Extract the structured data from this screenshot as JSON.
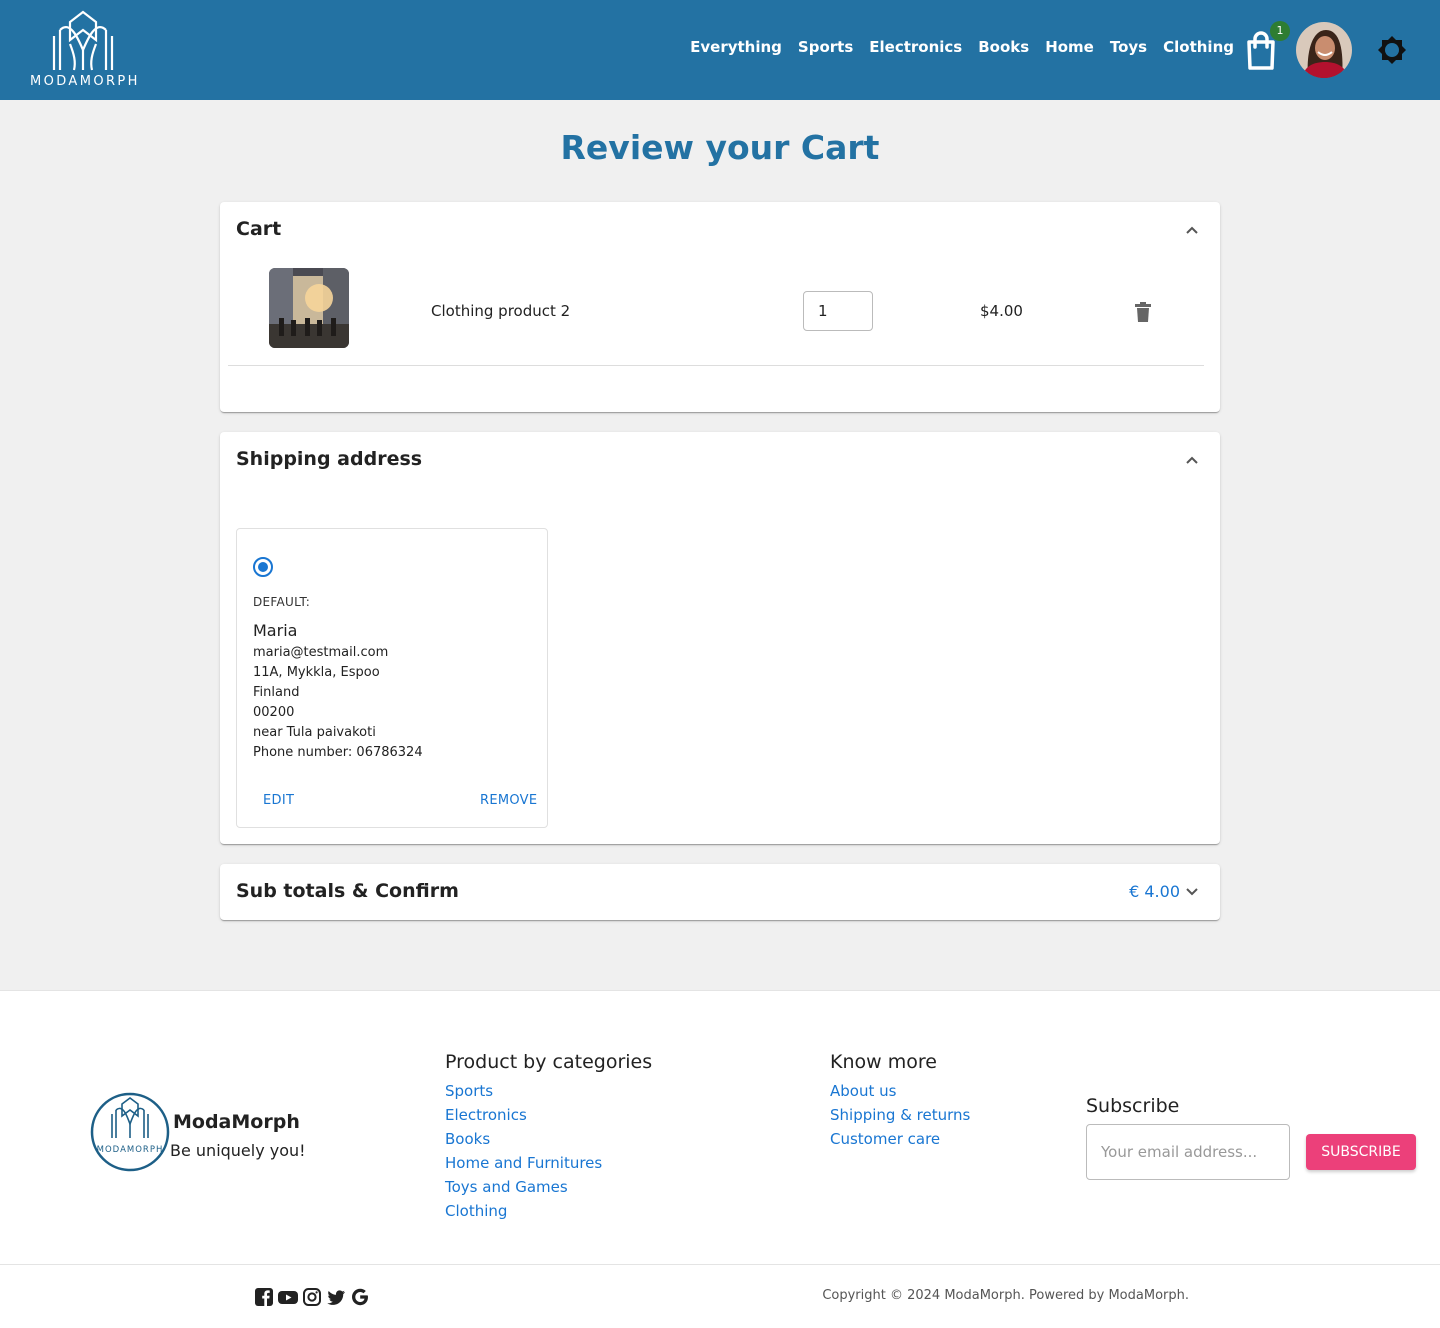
{
  "header": {
    "logo_text": "MODAMORPH",
    "nav": [
      "Everything",
      "Sports",
      "Electronics",
      "Books",
      "Home",
      "Toys",
      "Clothing"
    ],
    "cart_count": "1"
  },
  "page_title": "Review your Cart",
  "cart": {
    "title": "Cart",
    "items": [
      {
        "name": "Clothing product 2",
        "quantity": "1",
        "price": "$4.00"
      }
    ]
  },
  "shipping": {
    "title": "Shipping address",
    "address": {
      "default_label": "DEFAULT:",
      "name": "Maria",
      "email": "maria@testmail.com",
      "street": "11A, Mykkla, Espoo",
      "country": "Finland",
      "zip": "00200",
      "note": "near Tula paivakoti",
      "phone": "Phone number: 06786324",
      "edit_label": "EDIT",
      "remove_label": "REMOVE"
    }
  },
  "subtotal": {
    "title": "Sub totals & Confirm",
    "amount": "€ 4.00"
  },
  "footer": {
    "brand": "ModaMorph",
    "tagline": "Be uniquely you!",
    "logo_text": "MODAMORPH",
    "categories_title": "Product by categories",
    "categories": [
      "Sports",
      "Electronics",
      "Books",
      "Home and Furnitures",
      "Toys and Games",
      "Clothing"
    ],
    "know_more_title": "Know more",
    "know_more": [
      "About us",
      "Shipping & returns",
      "Customer care"
    ],
    "subscribe_title": "Subscribe",
    "email_placeholder": "Your email address...",
    "subscribe_label": "SUBSCRIBE",
    "copyright": "Copyright © 2024 ModaMorph. Powered by ModaMorph."
  },
  "icons": {
    "cart": "shopping-bag-icon",
    "theme": "brightness-icon",
    "delete": "trash-icon",
    "socials": [
      "facebook-icon",
      "youtube-icon",
      "instagram-icon",
      "twitter-icon",
      "google-icon"
    ]
  },
  "colors": {
    "brand": "#2372a3",
    "link": "#1976d2",
    "subscribe": "#ec407a",
    "badge": "#2e7d32"
  }
}
